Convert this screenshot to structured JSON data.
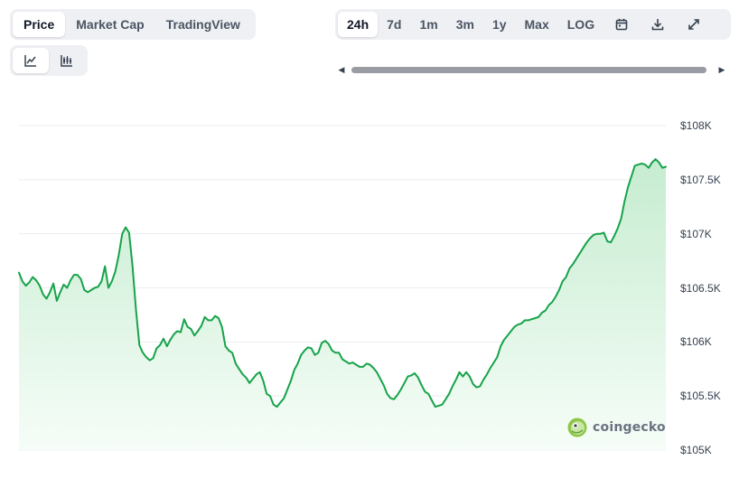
{
  "tabs": [
    {
      "label": "Price",
      "active": true
    },
    {
      "label": "Market Cap",
      "active": false
    },
    {
      "label": "TradingView",
      "active": false
    }
  ],
  "ranges": [
    {
      "label": "24h",
      "active": true
    },
    {
      "label": "7d",
      "active": false
    },
    {
      "label": "1m",
      "active": false
    },
    {
      "label": "3m",
      "active": false
    },
    {
      "label": "1y",
      "active": false
    },
    {
      "label": "Max",
      "active": false
    },
    {
      "label": "LOG",
      "active": false
    }
  ],
  "toolbar_icons": [
    "calendar-icon",
    "download-icon",
    "expand-icon"
  ],
  "chart_type_icons": [
    "line-chart-icon",
    "candlestick-chart-icon"
  ],
  "brand": "coingecko",
  "colors": {
    "line": "#16a34a",
    "fill_top": "#c6ecd0",
    "fill_bottom": "#f6fdf8",
    "grid": "#e9ecef"
  },
  "chart_data": {
    "type": "area",
    "title": "",
    "xlabel": "",
    "ylabel": "",
    "ylim": [
      105000,
      108000
    ],
    "yticks": [
      {
        "value": 108000,
        "label": "$108K"
      },
      {
        "value": 107500,
        "label": "$107.5K"
      },
      {
        "value": 107000,
        "label": "$107K"
      },
      {
        "value": 106500,
        "label": "$106.5K"
      },
      {
        "value": 106000,
        "label": "$106K"
      },
      {
        "value": 105500,
        "label": "$105.5K"
      },
      {
        "value": 105000,
        "label": "$105K"
      }
    ],
    "grid": true,
    "series": [
      {
        "values": [
          106640,
          106560,
          106520,
          106550,
          106600,
          106570,
          106520,
          106440,
          106400,
          106460,
          106540,
          106380,
          106460,
          106530,
          106500,
          106570,
          106620,
          106620,
          106580,
          106480,
          106460,
          106480,
          106500,
          106510,
          106560,
          106700,
          106500,
          106560,
          106650,
          106800,
          107000,
          107060,
          107010,
          106700,
          106300,
          105970,
          105900,
          105860,
          105830,
          105850,
          105940,
          105970,
          106030,
          105960,
          106020,
          106070,
          106100,
          106090,
          106210,
          106140,
          106120,
          106060,
          106100,
          106150,
          106230,
          106200,
          106200,
          106240,
          106220,
          106140,
          105960,
          105920,
          105900,
          105800,
          105750,
          105700,
          105670,
          105620,
          105660,
          105700,
          105720,
          105640,
          105520,
          105500,
          105420,
          105400,
          105440,
          105480,
          105560,
          105640,
          105740,
          105800,
          105880,
          105920,
          105950,
          105940,
          105880,
          105900,
          105990,
          106010,
          105980,
          105920,
          105900,
          105900,
          105840,
          105820,
          105800,
          105810,
          105790,
          105770,
          105770,
          105800,
          105790,
          105760,
          105720,
          105660,
          105600,
          105520,
          105480,
          105470,
          105510,
          105560,
          105620,
          105680,
          105690,
          105710,
          105670,
          105600,
          105540,
          105520,
          105460,
          105400,
          105410,
          105420,
          105470,
          105520,
          105590,
          105650,
          105720,
          105680,
          105720,
          105680,
          105610,
          105580,
          105590,
          105650,
          105700,
          105760,
          105810,
          105860,
          105960,
          106020,
          106060,
          106100,
          106140,
          106160,
          106170,
          106200,
          106200,
          106210,
          106220,
          106230,
          106270,
          106290,
          106340,
          106370,
          106420,
          106480,
          106560,
          106600,
          106680,
          106720,
          106770,
          106820,
          106870,
          106920,
          106960,
          106990,
          107000,
          107000,
          107010,
          106930,
          106920,
          106980,
          107050,
          107140,
          107300,
          107430,
          107530,
          107630,
          107640,
          107650,
          107640,
          107610,
          107660,
          107690,
          107660,
          107610,
          107620
        ]
      }
    ]
  }
}
